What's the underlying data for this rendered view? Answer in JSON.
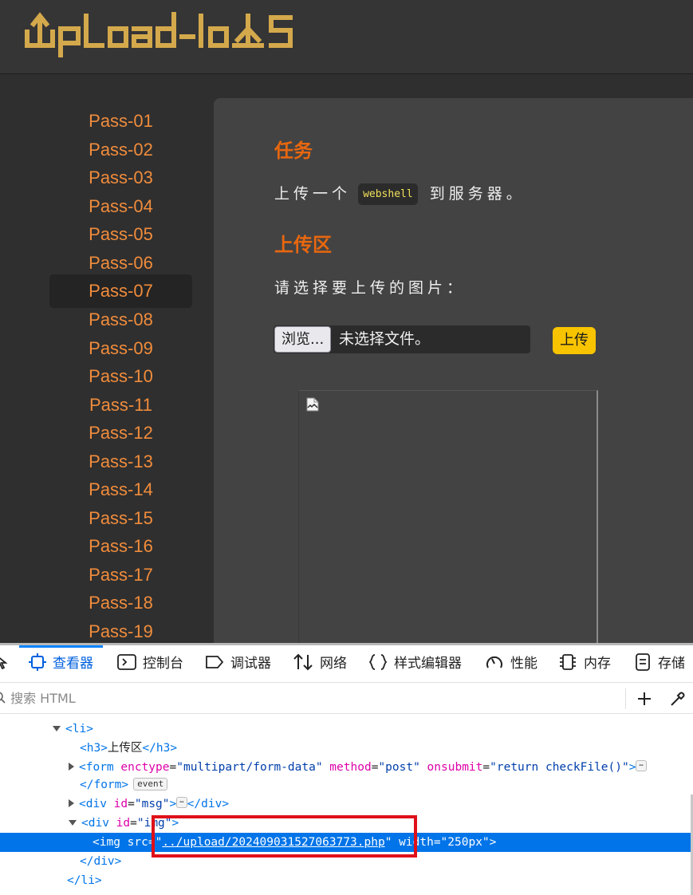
{
  "logo": {
    "text": "UpLoad-labS",
    "color": "#d4a94c"
  },
  "sidebar": {
    "items": [
      "Pass-01",
      "Pass-02",
      "Pass-03",
      "Pass-04",
      "Pass-05",
      "Pass-06",
      "Pass-07",
      "Pass-08",
      "Pass-09",
      "Pass-10",
      "Pass-11",
      "Pass-12",
      "Pass-13",
      "Pass-14",
      "Pass-15",
      "Pass-16",
      "Pass-17",
      "Pass-18",
      "Pass-19"
    ],
    "active_item": "Pass-07"
  },
  "main": {
    "task_title": "任务",
    "task_text_before": "上传一个",
    "task_code": "webshell",
    "task_text_after": "到服务器。",
    "upload_title": "上传区",
    "prompt": "请选择要上传的图片：",
    "browse_label": "浏览...",
    "file_status": "未选择文件。",
    "upload_label": "上传"
  },
  "devtools": {
    "tabs": [
      {
        "icon": "inspector-icon",
        "label": "查看器",
        "active": true
      },
      {
        "icon": "console-icon",
        "label": "控制台",
        "active": false
      },
      {
        "icon": "debugger-icon",
        "label": "调试器",
        "active": false
      },
      {
        "icon": "network-icon",
        "label": "网络",
        "active": false
      },
      {
        "icon": "style-editor-icon",
        "label": "样式编辑器",
        "active": false
      },
      {
        "icon": "performance-icon",
        "label": "性能",
        "active": false
      },
      {
        "icon": "memory-icon",
        "label": "内存",
        "active": false
      },
      {
        "icon": "storage-icon",
        "label": "存储",
        "active": false
      }
    ],
    "search_placeholder": "搜索 HTML",
    "tree": {
      "li_open": "<li>",
      "h3_open": "<h3>",
      "h3_text": "上传区",
      "h3_close": "</h3>",
      "form_tag": "<form",
      "form_enctype_attr": "enctype",
      "form_enctype_val": "\"multipart/form-data\"",
      "form_method_attr": "method",
      "form_method_val": "\"post\"",
      "form_onsubmit_attr": "onsubmit",
      "form_onsubmit_val": "\"return checkFile()\"",
      "form_gt": ">",
      "form_close": "</form>",
      "event_badge": "event",
      "div_tag": "<div",
      "id_attr": "id",
      "msg_val": "\"msg\"",
      "div_close": "</div>",
      "img_div_val": "\"img\"",
      "img_tag": "<img",
      "src_attr": "src",
      "src_val": "../upload/202409031527063773.php",
      "width_attr": "width",
      "width_val": "\"250px\"",
      "li_close": "</li>",
      "ellipsis": "⋯"
    },
    "accent": "#0074e8"
  }
}
